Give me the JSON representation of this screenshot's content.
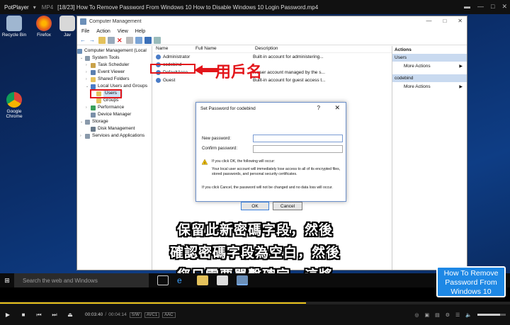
{
  "player": {
    "brand": "PotPlayer",
    "format": "MP4",
    "file_title": "[18/23] How To Remove Password From Windows 10  How to Disable Windows 10 Login Password.mp4",
    "time_current": "00:03:40",
    "time_total": "00:04:14",
    "tags": [
      "S/W",
      "AVC1",
      "AAC"
    ],
    "progress_fraction": 0.6,
    "volume_fraction": 0.8
  },
  "desktop": {
    "icons": [
      {
        "label": "Recycle Bin"
      },
      {
        "label": "Firefox"
      },
      {
        "label": "Jav"
      },
      {
        "label": "Google Chrome"
      }
    ]
  },
  "cm": {
    "title": "Computer Management",
    "menu": [
      "File",
      "Action",
      "View",
      "Help"
    ],
    "tree": [
      {
        "label": "Computer Management (Local"
      },
      {
        "label": "System Tools"
      },
      {
        "label": "Task Scheduler"
      },
      {
        "label": "Event Viewer"
      },
      {
        "label": "Shared Folders"
      },
      {
        "label": "Local Users and Groups"
      },
      {
        "label": "Users"
      },
      {
        "label": "Groups"
      },
      {
        "label": "Performance"
      },
      {
        "label": "Device Manager"
      },
      {
        "label": "Storage"
      },
      {
        "label": "Disk Management"
      },
      {
        "label": "Services and Applications"
      }
    ],
    "columns": [
      "Name",
      "Full Name",
      "Description"
    ],
    "rows": [
      {
        "name": "Administrator",
        "full": "",
        "desc": "Built-in account for administering..."
      },
      {
        "name": "codebind",
        "full": "",
        "desc": ""
      },
      {
        "name": "DefaultAcco...",
        "full": "",
        "desc": "A user account managed by the s..."
      },
      {
        "name": "Guest",
        "full": "",
        "desc": "Built-in account for guest access t..."
      }
    ],
    "actions": {
      "header": "Actions",
      "sections": [
        {
          "title": "Users",
          "item": "More Actions"
        },
        {
          "title": "codebind",
          "item": "More Actions"
        }
      ]
    }
  },
  "annotation": "用戶名",
  "dialog": {
    "title": "Set Password for codebind",
    "new_password_label": "New password:",
    "confirm_password_label": "Confirm password:",
    "warn_title": "If you click OK, the following will occur:",
    "warn_body": "Your local user account will immediately lose access to all of its encrypted files, stored passwords, and personal security certificates.",
    "cancel_note": "If you click Cancel, the password will not be changed and no data loss will occur.",
    "ok_label": "OK",
    "cancel_label": "Cancel"
  },
  "subtitles": [
    "保留此新密碼字段，然後",
    "確認密碼字段為空白，然後",
    "您只需要單擊確定，這將"
  ],
  "promo": "How To Remove Password From Windows 10",
  "taskbar": {
    "search_placeholder": "Search the web and Windows"
  }
}
